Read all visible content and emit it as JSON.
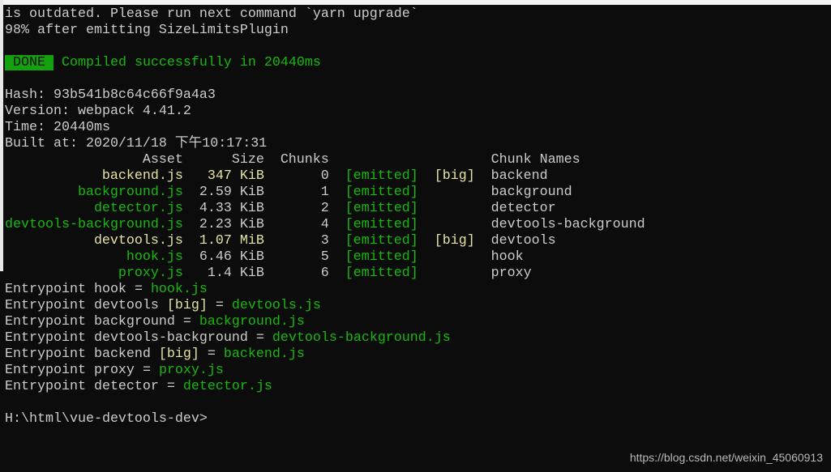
{
  "colors": {
    "default": "#cccccc",
    "green": "#16b90c",
    "yellow": "#e8e2a0",
    "done_bg": "#13a10e",
    "background": "#0c0c0c"
  },
  "lines": {
    "outdated": "is outdated. Please run next command `yarn upgrade`",
    "progress": "98% after emitting SizeLimitsPlugin",
    "done_badge": "DONE",
    "compiled": "Compiled successfully in 20440ms",
    "hash": "Hash: 93b541b8c64c66f9a4a3",
    "version": "Version: webpack 4.41.2",
    "time": "Time: 20440ms",
    "built": "Built at: 2020/11/18 下午10:17:31"
  },
  "table": {
    "headers": {
      "asset": "Asset",
      "size": "Size",
      "chunks": "Chunks",
      "names": "Chunk Names"
    },
    "rows": [
      {
        "asset": "backend.js",
        "size": "347 KiB",
        "chunks": "0",
        "status": "[emitted]",
        "big": "[big]",
        "names": "backend",
        "color": "y"
      },
      {
        "asset": "background.js",
        "size": "2.59 KiB",
        "chunks": "1",
        "status": "[emitted]",
        "big": "",
        "names": "background",
        "color": "g"
      },
      {
        "asset": "detector.js",
        "size": "4.33 KiB",
        "chunks": "2",
        "status": "[emitted]",
        "big": "",
        "names": "detector",
        "color": "g"
      },
      {
        "asset": "devtools-background.js",
        "size": "2.23 KiB",
        "chunks": "4",
        "status": "[emitted]",
        "big": "",
        "names": "devtools-background",
        "color": "g"
      },
      {
        "asset": "devtools.js",
        "size": "1.07 MiB",
        "chunks": "3",
        "status": "[emitted]",
        "big": "[big]",
        "names": "devtools",
        "color": "y"
      },
      {
        "asset": "hook.js",
        "size": "6.46 KiB",
        "chunks": "5",
        "status": "[emitted]",
        "big": "",
        "names": "hook",
        "color": "g"
      },
      {
        "asset": "proxy.js",
        "size": "1.4 KiB",
        "chunks": "6",
        "status": "[emitted]",
        "big": "",
        "names": "proxy",
        "color": "g"
      }
    ]
  },
  "entrypoints": [
    {
      "prefix": "Entrypoint hook",
      "big": "",
      "file": "hook.js"
    },
    {
      "prefix": "Entrypoint devtools",
      "big": "[big]",
      "file": "devtools.js"
    },
    {
      "prefix": "Entrypoint background",
      "big": "",
      "file": "background.js"
    },
    {
      "prefix": "Entrypoint devtools-background",
      "big": "",
      "file": "devtools-background.js"
    },
    {
      "prefix": "Entrypoint backend",
      "big": "[big]",
      "file": "backend.js"
    },
    {
      "prefix": "Entrypoint proxy",
      "big": "",
      "file": "proxy.js"
    },
    {
      "prefix": "Entrypoint detector",
      "big": "",
      "file": "detector.js"
    }
  ],
  "equals": "=",
  "prompt": "H:\\html\\vue-devtools-dev>",
  "watermark": "https://blog.csdn.net/weixin_45060913"
}
